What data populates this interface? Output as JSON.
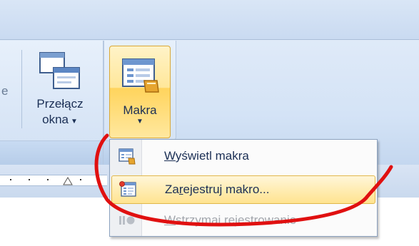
{
  "ribbon": {
    "partial_label": "e",
    "switch_windows": {
      "label_line1": "Przełącz",
      "label_line2": "okna",
      "caret": "▼",
      "icon": "switch-windows-icon"
    },
    "macros": {
      "label": "Makra",
      "caret": "▼",
      "icon": "macros-icon"
    }
  },
  "menu": {
    "items": [
      {
        "label_pre": "",
        "mnemonic": "W",
        "label_post": "yświetl makra",
        "icon": "view-macros-icon",
        "state": "normal"
      },
      {
        "label_pre": "Za",
        "mnemonic": "r",
        "label_post": "ejestruj makro...",
        "icon": "record-macro-icon",
        "state": "highlighted"
      },
      {
        "label_pre": "",
        "mnemonic": "W",
        "label_post": "strzymaj rejestrowanie",
        "icon": "pause-recording-icon",
        "state": "disabled"
      }
    ]
  },
  "colors": {
    "annotation": "#e01010",
    "highlight": "#ffe38f",
    "ribbon": "#d4e3f6"
  }
}
